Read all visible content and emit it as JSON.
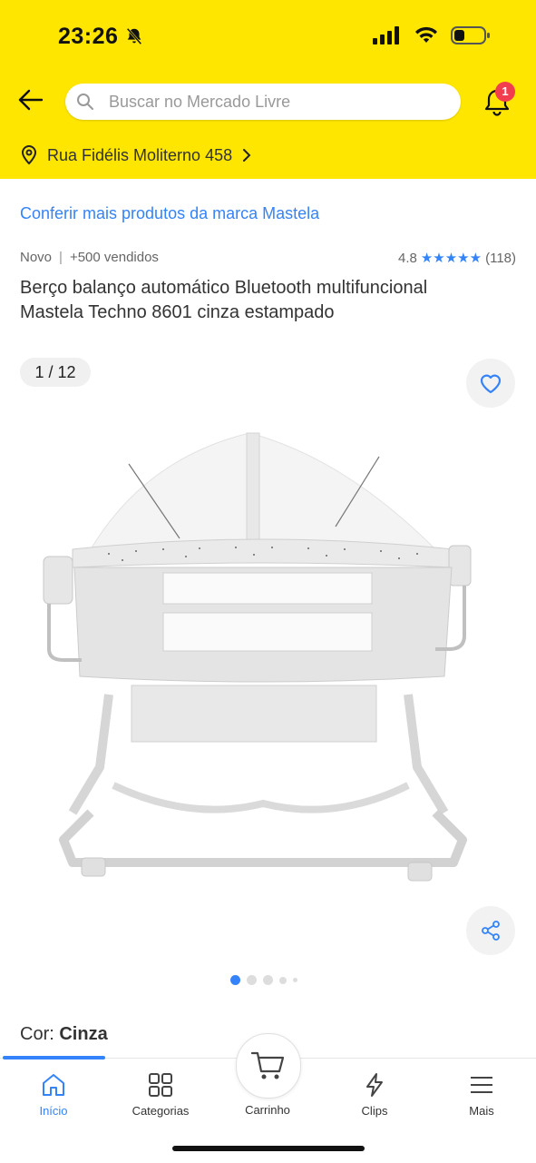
{
  "status_bar": {
    "time": "23:26"
  },
  "header": {
    "search_placeholder": "Buscar no Mercado Livre",
    "notification_count": "1",
    "address": "Rua Fidélis Moliterno 458"
  },
  "product": {
    "brand_link": "Conferir mais produtos da marca Mastela",
    "condition": "Novo",
    "separator": "|",
    "sold": "+500 vendidos",
    "rating": "4.8",
    "stars": "★★★★★",
    "reviews": "(118)",
    "title": "Berço balanço automático Bluetooth multifuncional Mastela Techno 8601 cinza estampado",
    "gallery_counter": "1 / 12",
    "gallery_current": 1,
    "gallery_total": 12,
    "color_label": "Cor:",
    "color_value": "Cinza"
  },
  "tabbar": {
    "items": [
      {
        "label": "Início",
        "icon": "home-icon"
      },
      {
        "label": "Categorias",
        "icon": "grid-icon"
      },
      {
        "label": "Carrinho",
        "icon": "cart-icon"
      },
      {
        "label": "Clips",
        "icon": "lightning-icon"
      },
      {
        "label": "Mais",
        "icon": "menu-icon"
      }
    ]
  },
  "colors": {
    "brand_yellow": "#FFE600",
    "accent_blue": "#3483FA",
    "badge_red": "#F23D4F"
  }
}
